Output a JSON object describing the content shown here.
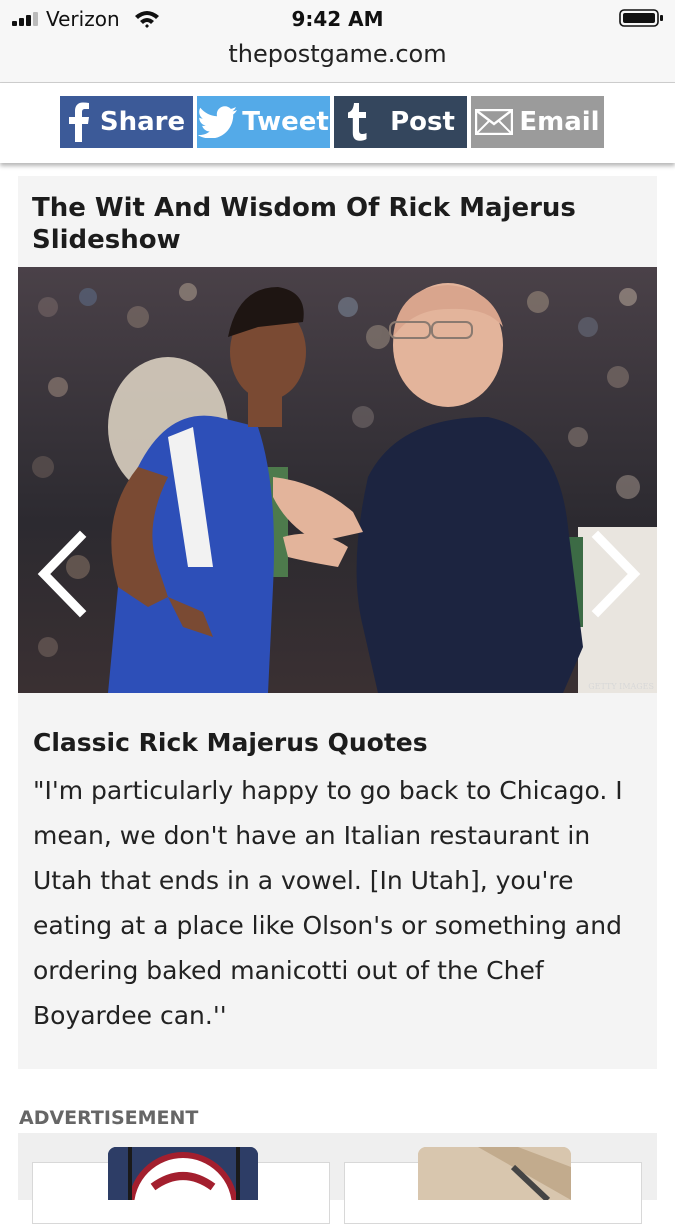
{
  "status_bar": {
    "carrier": "Verizon",
    "time": "9:42 AM"
  },
  "browser": {
    "url": "thepostgame.com"
  },
  "share_bar": {
    "facebook_label": "Share",
    "twitter_label": "Tweet",
    "tumblr_label": "Post",
    "email_label": "Email",
    "colors": {
      "facebook": "#3c5a98",
      "twitter": "#54aae8",
      "tumblr": "#34465d",
      "email": "#9b9b9b"
    }
  },
  "slideshow": {
    "title": "The Wit And Wisdom Of Rick Majerus Slideshow",
    "photo_credit": "GETTY IMAGES",
    "slide_heading": "Classic Rick Majerus Quotes",
    "slide_text": "\"I'm particularly happy to go back to Chicago. I mean, we don't have an Italian restaurant in Utah that ends in a vowel. [In Utah], you're eating at a place like Olson's or something and ordering baked manicotti out of the Chef Boyardee can.''"
  },
  "advertisement": {
    "label": "ADVERTISEMENT"
  }
}
